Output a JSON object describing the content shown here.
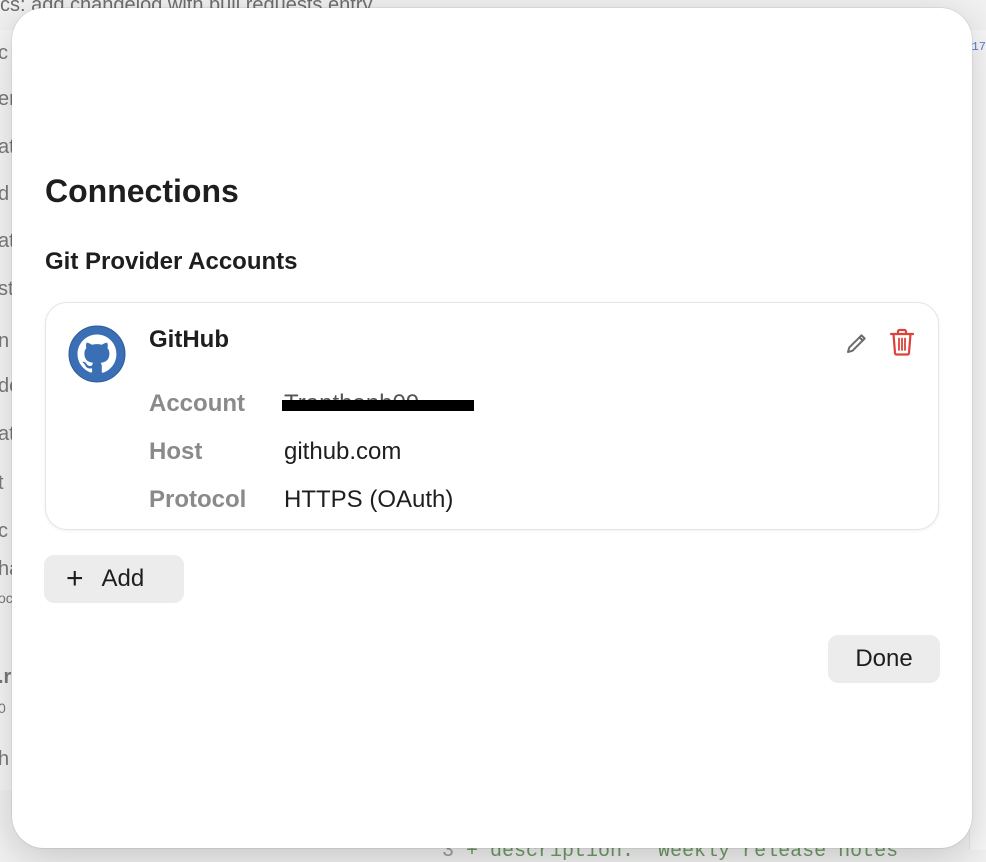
{
  "background": {
    "top_text": "cs: add changelog with pull requests entry",
    "left_fragments": [
      "c",
      "er",
      "at",
      "d",
      "at",
      "st",
      "n",
      "de",
      "at",
      "t",
      "c",
      "ha",
      "oc",
      ".r",
      "0",
      "h"
    ],
    "right_number": "17",
    "code_line_number": "3",
    "code_text": "+ description: \"Weekly release notes"
  },
  "dialog": {
    "title": "Connections",
    "section_title": "Git Provider Accounts",
    "account": {
      "provider_icon": "github-logo-icon",
      "provider_name": "GitHub",
      "account_label": "Account",
      "account_value": "Tranthanh09",
      "host_label": "Host",
      "host_value": "github.com",
      "protocol_label": "Protocol",
      "protocol_value": "HTTPS (OAuth)",
      "edit_icon": "pencil-icon",
      "delete_icon": "trash-icon"
    },
    "add_button_label": "Add",
    "add_icon": "plus-icon",
    "done_button_label": "Done"
  },
  "colors": {
    "accent_delete": "#e0403a",
    "github_logo": "#3a6fb5",
    "button_bg": "#ececec"
  }
}
